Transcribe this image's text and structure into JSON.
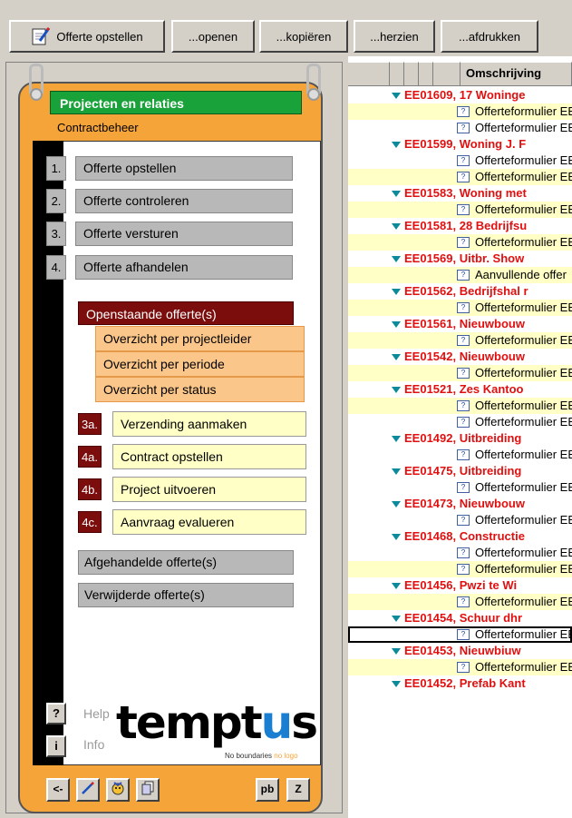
{
  "toolbar": {
    "buttons": [
      "Offerte opstellen",
      "...openen",
      "...kopiëren",
      "...herzien",
      "...afdrukken"
    ]
  },
  "panel": {
    "title": "Projecten en relaties",
    "subtitle": "Contractbeheer",
    "steps": [
      {
        "num": "1.",
        "label": "Offerte opstellen"
      },
      {
        "num": "2.",
        "label": "Offerte controleren"
      },
      {
        "num": "3.",
        "label": "Offerte versturen"
      },
      {
        "num": "4.",
        "label": "Offerte afhandelen"
      }
    ],
    "open_offers": "Openstaande offerte(s)",
    "overviews": [
      "Overzicht per projectleider",
      "Overzicht per periode",
      "Overzicht per status"
    ],
    "actions": [
      {
        "num": "3a.",
        "label": "Verzending aanmaken"
      },
      {
        "num": "4a.",
        "label": "Contract opstellen"
      },
      {
        "num": "4b.",
        "label": "Project uitvoeren"
      },
      {
        "num": "4c.",
        "label": "Aanvraag evalueren"
      }
    ],
    "handled": "Afgehandelde offerte(s)",
    "deleted": "Verwijderde offerte(s)",
    "help_btn": "?",
    "help_label": "Help",
    "info_btn": "i",
    "info_label": "Info",
    "logo": {
      "pre": "tempt",
      "u": "u",
      "post": "s"
    },
    "tagline_pre": "No boundaries",
    "tagline_post": "no logo",
    "bottom_buttons": {
      "back": "<-",
      "pb": "pb",
      "z": "Z"
    }
  },
  "grid": {
    "column_header": "Omschrijving",
    "rows": [
      {
        "type": "project",
        "text": "EE01609, 17 Woninge"
      },
      {
        "type": "doc",
        "text": "Offerteformulier EE",
        "yellow": true
      },
      {
        "type": "doc",
        "text": "Offerteformulier EE",
        "yellow": false
      },
      {
        "type": "project",
        "text": "EE01599, Woning J. F"
      },
      {
        "type": "doc",
        "text": "Offerteformulier EE",
        "yellow": false
      },
      {
        "type": "doc",
        "text": "Offerteformulier EE",
        "yellow": true
      },
      {
        "type": "project",
        "text": "EE01583, Woning met"
      },
      {
        "type": "doc",
        "text": "Offerteformulier EE",
        "yellow": true
      },
      {
        "type": "project",
        "text": "EE01581, 28 Bedrijfsu"
      },
      {
        "type": "doc",
        "text": "Offerteformulier EE",
        "yellow": true
      },
      {
        "type": "project",
        "text": "EE01569, Uitbr. Show"
      },
      {
        "type": "doc",
        "text": "Aanvullende offer",
        "yellow": true
      },
      {
        "type": "project",
        "text": "EE01562, Bedrijfshal r"
      },
      {
        "type": "doc",
        "text": "Offerteformulier EE",
        "yellow": true
      },
      {
        "type": "project",
        "text": "EE01561, Nieuwbouw"
      },
      {
        "type": "doc",
        "text": "Offerteformulier EE",
        "yellow": true
      },
      {
        "type": "project",
        "text": "EE01542, Nieuwbouw"
      },
      {
        "type": "doc",
        "text": "Offerteformulier EE",
        "yellow": true
      },
      {
        "type": "project",
        "text": "EE01521, Zes Kantoo"
      },
      {
        "type": "doc",
        "text": "Offerteformulier EE",
        "yellow": true
      },
      {
        "type": "doc",
        "text": "Offerteformulier EE",
        "yellow": false
      },
      {
        "type": "project",
        "text": "EE01492, Uitbreiding"
      },
      {
        "type": "doc",
        "text": "Offerteformulier EE",
        "yellow": false
      },
      {
        "type": "project",
        "text": "EE01475, Uitbreiding"
      },
      {
        "type": "doc",
        "text": "Offerteformulier EE",
        "yellow": false
      },
      {
        "type": "project",
        "text": "EE01473, Nieuwbouw"
      },
      {
        "type": "doc",
        "text": "Offerteformulier EE",
        "yellow": false
      },
      {
        "type": "project",
        "text": "EE01468, Constructie"
      },
      {
        "type": "doc",
        "text": "Offerteformulier EE",
        "yellow": false
      },
      {
        "type": "doc",
        "text": "Offerteformulier EE",
        "yellow": true
      },
      {
        "type": "project",
        "text": "EE01456, Pwzi te Wi"
      },
      {
        "type": "doc",
        "text": "Offerteformulier EE",
        "yellow": true
      },
      {
        "type": "project",
        "text": "EE01454, Schuur dhr"
      },
      {
        "type": "doc",
        "text": "Offerteformulier EE",
        "yellow": false,
        "selected": true
      },
      {
        "type": "project",
        "text": "EE01453, Nieuwbiuw"
      },
      {
        "type": "doc",
        "text": "Offerteformulier EE",
        "yellow": true
      },
      {
        "type": "project",
        "text": "EE01452, Prefab Kant"
      }
    ]
  }
}
